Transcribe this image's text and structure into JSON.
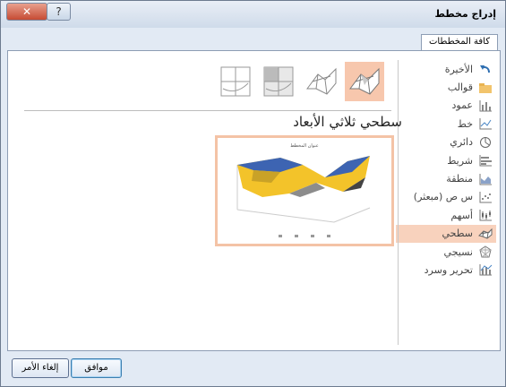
{
  "window": {
    "title": "إدراج مخطط"
  },
  "tabs": [
    {
      "label": "كافة المخططات"
    }
  ],
  "sidebar": {
    "items": [
      {
        "label": "الأخيرة",
        "icon": "undo-icon"
      },
      {
        "label": "قوالب",
        "icon": "folder-icon"
      },
      {
        "label": "عمود",
        "icon": "column-chart-icon"
      },
      {
        "label": "خط",
        "icon": "line-chart-icon"
      },
      {
        "label": "دائري",
        "icon": "pie-chart-icon"
      },
      {
        "label": "شريط",
        "icon": "bar-chart-icon"
      },
      {
        "label": "منطقة",
        "icon": "area-chart-icon"
      },
      {
        "label": "س ص (مبعثر)",
        "icon": "scatter-chart-icon"
      },
      {
        "label": "أسهم",
        "icon": "stock-chart-icon"
      },
      {
        "label": "سطحي",
        "icon": "surface-chart-icon",
        "selected": true
      },
      {
        "label": "نسيجي",
        "icon": "radar-chart-icon"
      },
      {
        "label": "تحرير وسرد",
        "icon": "combo-chart-icon"
      }
    ]
  },
  "main": {
    "subtypes": [
      {
        "name": "contour-surface"
      },
      {
        "name": "wireframe-contour-surface"
      },
      {
        "name": "wireframe-3d-surface"
      },
      {
        "name": "3d-surface",
        "selected": true
      }
    ],
    "chart_type_title": "سطحي ثلاثي الأبعاد",
    "preview_title": "عنوان المخطط"
  },
  "buttons": {
    "ok": "موافق",
    "cancel": "إلغاء الأمر"
  },
  "colors": {
    "selection": "#f8d2bd",
    "accent": "#f4c3a6"
  }
}
